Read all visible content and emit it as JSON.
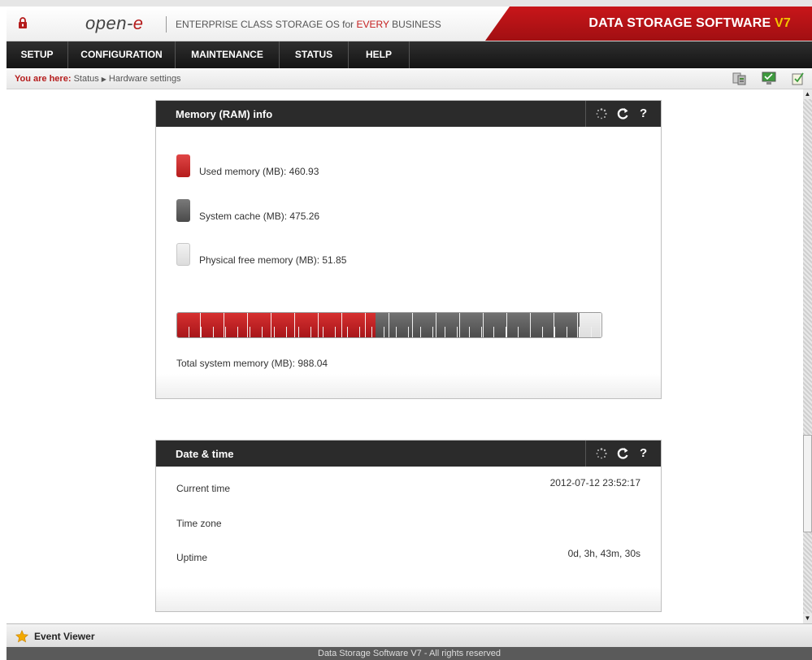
{
  "header": {
    "logo_text": "open-",
    "logo_accent": "e",
    "tagline_prefix": "ENTERPRISE CLASS STORAGE OS for ",
    "tagline_highlight": "EVERY",
    "tagline_suffix": " BUSINESS",
    "brand_title": "DATA STORAGE SOFTWARE ",
    "brand_version": "V7"
  },
  "nav": {
    "items": [
      {
        "label": "SETUP"
      },
      {
        "label": "CONFIGURATION"
      },
      {
        "label": "MAINTENANCE"
      },
      {
        "label": "STATUS"
      },
      {
        "label": "HELP"
      }
    ]
  },
  "breadcrumb": {
    "prefix": "You are here:",
    "items": [
      "Status",
      "Hardware settings"
    ],
    "separator": "▶"
  },
  "toolbar_icons": [
    "database-icon",
    "monitor-icon",
    "notes-icon"
  ],
  "memory_panel": {
    "title": "Memory (RAM) info",
    "tools": [
      "spinner-icon",
      "refresh-icon",
      "help-icon"
    ],
    "legend": [
      {
        "label": "Used memory (MB): 460.93",
        "color": "#c41e1e"
      },
      {
        "label": "System cache (MB): 475.26",
        "color": "#555555"
      },
      {
        "label": "Physical free memory (MB): 51.85",
        "color": "#e6e6e6"
      }
    ],
    "usage": {
      "used_mb": 460.93,
      "cache_mb": 475.26,
      "free_mb": 51.85
    },
    "total_label": "Total system memory (MB): 988.04"
  },
  "date_panel": {
    "title": "Date & time",
    "tools": [
      "spinner-icon",
      "refresh-icon",
      "help-icon"
    ],
    "rows": [
      {
        "label": "Current time",
        "value": "2012-07-12 23:52:17"
      },
      {
        "label": "Time zone",
        "value": ""
      },
      {
        "label": "Uptime",
        "value": "0d, 3h, 43m, 30s"
      }
    ]
  },
  "bottom_bar": {
    "event_viewer": "Event Viewer"
  },
  "footer": {
    "text": "Data Storage Software V7 - All rights reserved"
  }
}
